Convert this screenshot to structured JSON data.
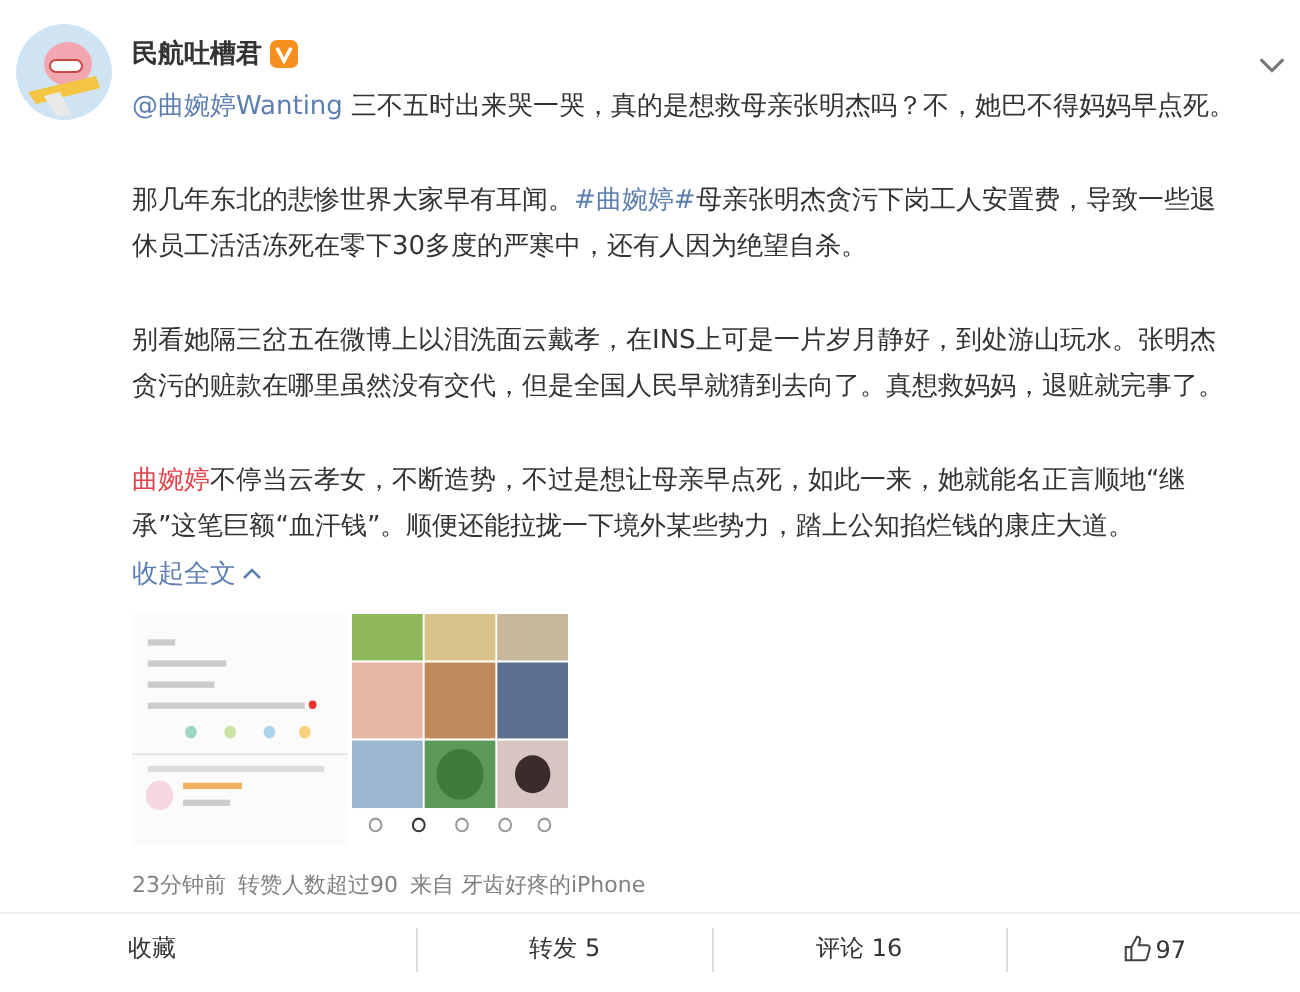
{
  "author": {
    "name": "民航吐槽君",
    "verified": true
  },
  "paragraphs": [
    [
      {
        "kind": "mention",
        "text": "@曲婉婷Wanting"
      },
      {
        "kind": "text",
        "text": " 三不五时出来哭一哭，真的是想救母亲张明杰吗？不，她巴不得妈妈早点死。"
      }
    ],
    [
      {
        "kind": "text",
        "text": "那几年东北的悲惨世界大家早有耳闻。"
      },
      {
        "kind": "hashtag",
        "text": "#曲婉婷#"
      },
      {
        "kind": "text",
        "text": "母亲张明杰贪污下岗工人安置费，导致一些退休员工活活冻死在零下30多度的严寒中，还有人因为绝望自杀。"
      }
    ],
    [
      {
        "kind": "text",
        "text": "别看她隔三岔五在微博上以泪洗面云戴孝，在INS上可是一片岁月静好，到处游山玩水。张明杰贪污的赃款在哪里虽然没有交代，但是全国人民早就猜到去向了。真想救妈妈，退赃就完事了。"
      }
    ],
    [
      {
        "kind": "keyword",
        "text": "曲婉婷"
      },
      {
        "kind": "text",
        "text": "不停当云孝女，不断造势，不过是想让母亲早点死，如此一来，她就能名正言顺地“继承”这笔巨额“血汗钱”。顺便还能拉拢一下境外某些势力，踏上公知掐烂钱的康庄大道。 "
      },
      {
        "kind": "collapse",
        "text": "收起全文"
      }
    ]
  ],
  "images": [
    {
      "kind": "picture"
    },
    {
      "kind": "picture"
    }
  ],
  "meta": {
    "time": "23分钟前",
    "reposts_note": "转赞人数超过90",
    "source": "来自 牙齿好疼的iPhone"
  },
  "actions": [
    {
      "kind": "favorite",
      "label": "收藏"
    },
    {
      "kind": "repost",
      "label": "转发 5"
    },
    {
      "kind": "comment",
      "label": "评论 16"
    },
    {
      "kind": "like",
      "label": "97"
    }
  ]
}
